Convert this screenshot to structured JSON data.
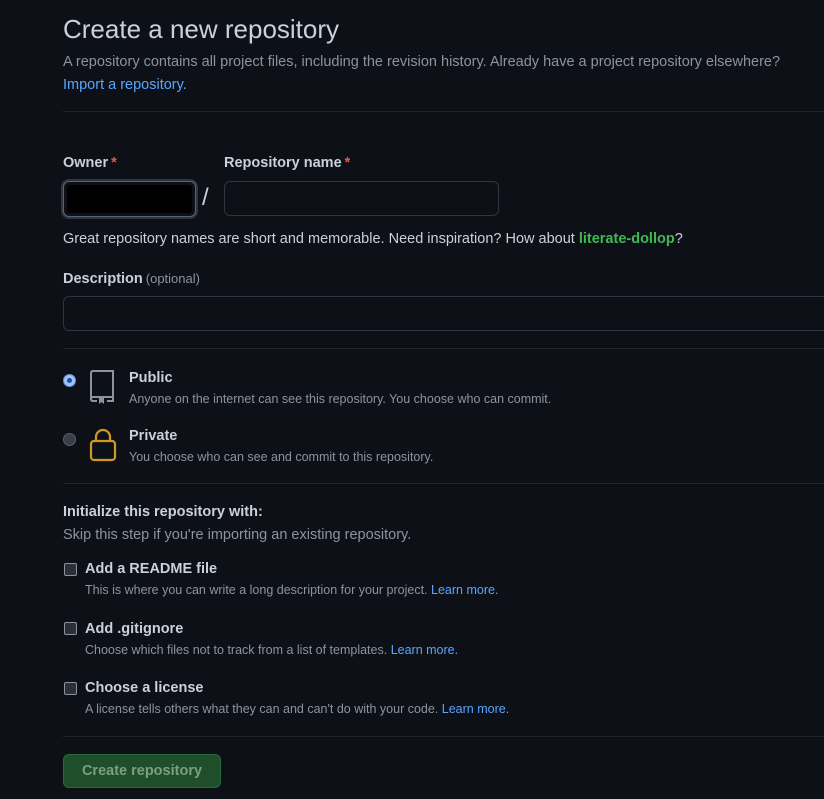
{
  "header": {
    "title": "Create a new repository",
    "subtitle": "A repository contains all project files, including the revision history. Already have a project repository elsewhere?",
    "import_link": "Import a repository."
  },
  "owner": {
    "label": "Owner",
    "required_mark": "*"
  },
  "repo_name": {
    "label": "Repository name",
    "required_mark": "*",
    "value": ""
  },
  "separator": "/",
  "hint": {
    "prefix": "Great repository names are short and memorable. Need inspiration? How about ",
    "suggestion": "literate-dollop",
    "suffix": "?"
  },
  "description": {
    "label": "Description",
    "optional": "(optional)",
    "value": ""
  },
  "visibility": {
    "public": {
      "title": "Public",
      "desc": "Anyone on the internet can see this repository. You choose who can commit.",
      "selected": true,
      "icon": "repo-icon"
    },
    "private": {
      "title": "Private",
      "desc": "You choose who can see and commit to this repository.",
      "selected": false,
      "icon": "lock-icon"
    }
  },
  "init": {
    "title": "Initialize this repository with:",
    "subtitle": "Skip this step if you're importing an existing repository.",
    "readme": {
      "title": "Add a README file",
      "desc": "This is where you can write a long description for your project.",
      "link": "Learn more."
    },
    "gitignore": {
      "title": "Add .gitignore",
      "desc": "Choose which files not to track from a list of templates.",
      "link": "Learn more."
    },
    "license": {
      "title": "Choose a license",
      "desc": "A license tells others what they can and can't do with your code.",
      "link": "Learn more."
    }
  },
  "actions": {
    "create_label": "Create repository"
  },
  "colors": {
    "background": "#0d1117",
    "link": "#58a6ff",
    "required": "#f85149",
    "suggestion": "#3fb950",
    "private_icon": "#d29922",
    "button": "#1f4f2a"
  }
}
